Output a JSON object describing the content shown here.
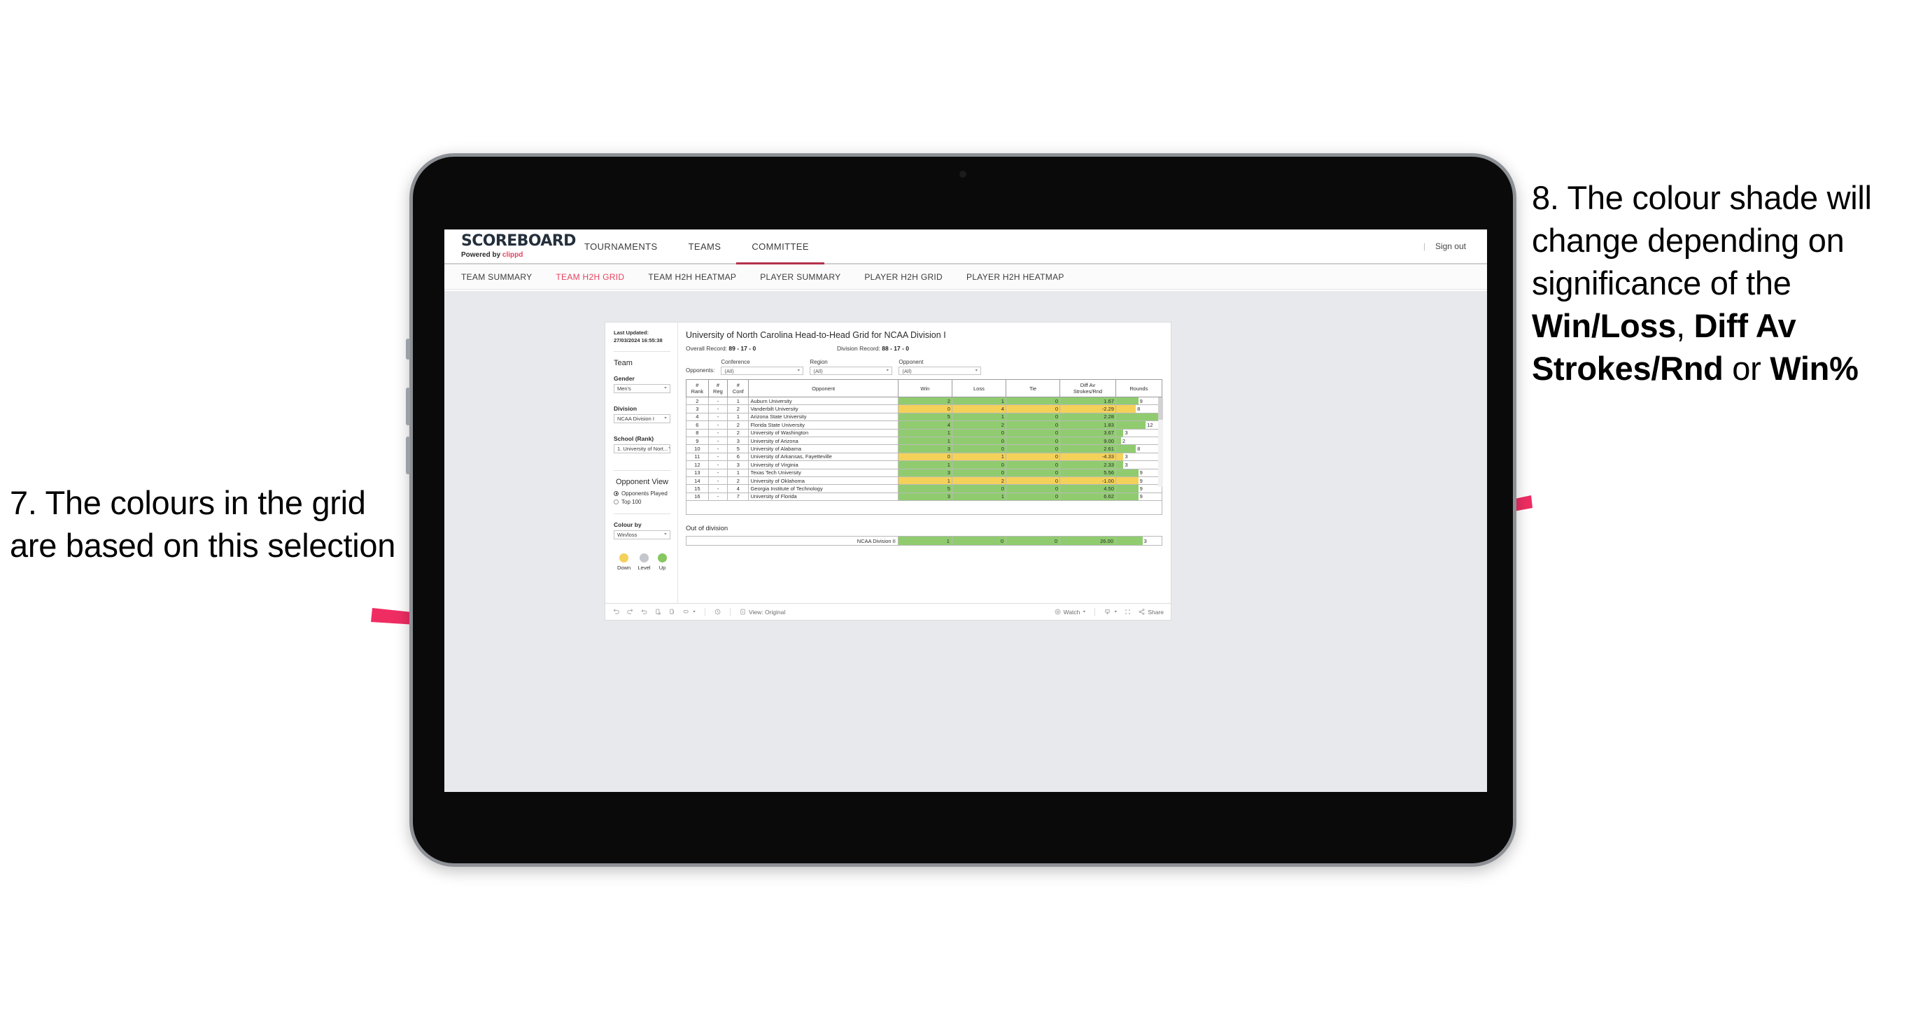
{
  "annotations": {
    "left": {
      "id": "7",
      "text": "7. The colours in the grid are based on this selection"
    },
    "right": {
      "id": "8",
      "line1": "8. The colour shade will change depending on significance of the ",
      "bold1": "Win/Loss",
      "mid1": ", ",
      "bold2": "Diff Av Strokes/Rnd",
      "mid2": " or ",
      "bold3": "Win%"
    },
    "arrow_color": "#ef2d63"
  },
  "app": {
    "brand": {
      "name": "SCOREBOARD",
      "powered_prefix": "Powered by ",
      "powered_brand": "clippd"
    },
    "top_nav": [
      {
        "label": "TOURNAMENTS",
        "active": false
      },
      {
        "label": "TEAMS",
        "active": false
      },
      {
        "label": "COMMITTEE",
        "active": true
      }
    ],
    "sign_out": "Sign out",
    "sub_nav": [
      {
        "label": "TEAM SUMMARY",
        "active": false
      },
      {
        "label": "TEAM H2H GRID",
        "active": true
      },
      {
        "label": "TEAM H2H HEATMAP",
        "active": false
      },
      {
        "label": "PLAYER SUMMARY",
        "active": false
      },
      {
        "label": "PLAYER H2H GRID",
        "active": false
      },
      {
        "label": "PLAYER H2H HEATMAP",
        "active": false
      }
    ]
  },
  "pane": {
    "last_updated_label": "Last Updated: ",
    "last_updated_value": "27/03/2024 16:55:38",
    "team_heading": "Team",
    "gender_label": "Gender",
    "gender_value": "Men's",
    "division_label": "Division",
    "division_value": "NCAA Division I",
    "school_label": "School (Rank)",
    "school_value": "1. University of Nort...",
    "opponent_view_heading": "Opponent View",
    "opponent_view_options": [
      {
        "label": "Opponents Played",
        "selected": true
      },
      {
        "label": "Top 100",
        "selected": false
      }
    ],
    "colour_by_label": "Colour by",
    "colour_by_value": "Win/loss",
    "legend": [
      {
        "label": "Down",
        "color": "#f4d159"
      },
      {
        "label": "Level",
        "color": "#c4c7cc"
      },
      {
        "label": "Up",
        "color": "#86c760"
      }
    ]
  },
  "viz": {
    "title": "University of North Carolina Head-to-Head Grid for NCAA Division I",
    "overall_record_label": "Overall Record: ",
    "overall_record_value": "89 - 17 - 0",
    "division_record_label": "Division Record: ",
    "division_record_value": "88 - 17 - 0",
    "opponents_label": "Opponents:",
    "filters": [
      {
        "label": "Conference",
        "value": "(All)"
      },
      {
        "label": "Region",
        "value": "(All)"
      },
      {
        "label": "Opponent",
        "value": "(All)"
      }
    ],
    "columns": [
      "# Rank",
      "# Reg",
      "# Conf",
      "Opponent",
      "Win",
      "Loss",
      "Tie",
      "Diff Av Strokes/Rnd",
      "Rounds"
    ],
    "columns_split": [
      {
        "l1": "#",
        "l2": "Rank"
      },
      {
        "l1": "#",
        "l2": "Reg"
      },
      {
        "l1": "#",
        "l2": "Conf"
      },
      {
        "l1": "",
        "l2": "Opponent"
      },
      {
        "l1": "",
        "l2": "Win"
      },
      {
        "l1": "",
        "l2": "Loss"
      },
      {
        "l1": "",
        "l2": "Tie"
      },
      {
        "l1": "Diff Av",
        "l2": "Strokes/Rnd"
      },
      {
        "l1": "",
        "l2": "Rounds"
      }
    ],
    "rows": [
      {
        "rank": "2",
        "reg": "-",
        "conf": "1",
        "opponent": "Auburn University",
        "win": "2",
        "loss": "1",
        "tie": "0",
        "diff": "1.67",
        "rounds": "9",
        "state": "up"
      },
      {
        "rank": "3",
        "reg": "-",
        "conf": "2",
        "opponent": "Vanderbilt University",
        "win": "0",
        "loss": "4",
        "tie": "0",
        "diff": "-2.29",
        "rounds": "8",
        "state": "down"
      },
      {
        "rank": "4",
        "reg": "-",
        "conf": "1",
        "opponent": "Arizona State University",
        "win": "5",
        "loss": "1",
        "tie": "0",
        "diff": "2.28",
        "rounds": "17",
        "state": "up"
      },
      {
        "rank": "6",
        "reg": "-",
        "conf": "2",
        "opponent": "Florida State University",
        "win": "4",
        "loss": "2",
        "tie": "0",
        "diff": "1.83",
        "rounds": "12",
        "state": "up"
      },
      {
        "rank": "8",
        "reg": "-",
        "conf": "2",
        "opponent": "University of Washington",
        "win": "1",
        "loss": "0",
        "tie": "0",
        "diff": "3.67",
        "rounds": "3",
        "state": "up"
      },
      {
        "rank": "9",
        "reg": "-",
        "conf": "3",
        "opponent": "University of Arizona",
        "win": "1",
        "loss": "0",
        "tie": "0",
        "diff": "9.00",
        "rounds": "2",
        "state": "up"
      },
      {
        "rank": "10",
        "reg": "-",
        "conf": "5",
        "opponent": "University of Alabama",
        "win": "3",
        "loss": "0",
        "tie": "0",
        "diff": "2.61",
        "rounds": "8",
        "state": "up"
      },
      {
        "rank": "11",
        "reg": "-",
        "conf": "6",
        "opponent": "University of Arkansas, Fayetteville",
        "win": "0",
        "loss": "1",
        "tie": "0",
        "diff": "-4.33",
        "rounds": "3",
        "state": "down"
      },
      {
        "rank": "12",
        "reg": "-",
        "conf": "3",
        "opponent": "University of Virginia",
        "win": "1",
        "loss": "0",
        "tie": "0",
        "diff": "2.33",
        "rounds": "3",
        "state": "up"
      },
      {
        "rank": "13",
        "reg": "-",
        "conf": "1",
        "opponent": "Texas Tech University",
        "win": "3",
        "loss": "0",
        "tie": "0",
        "diff": "5.56",
        "rounds": "9",
        "state": "up"
      },
      {
        "rank": "14",
        "reg": "-",
        "conf": "2",
        "opponent": "University of Oklahoma",
        "win": "1",
        "loss": "2",
        "tie": "0",
        "diff": "-1.00",
        "rounds": "9",
        "state": "down"
      },
      {
        "rank": "15",
        "reg": "-",
        "conf": "4",
        "opponent": "Georgia Institute of Technology",
        "win": "5",
        "loss": "0",
        "tie": "0",
        "diff": "4.50",
        "rounds": "9",
        "state": "up"
      },
      {
        "rank": "16",
        "reg": "-",
        "conf": "7",
        "opponent": "University of Florida",
        "win": "3",
        "loss": "1",
        "tie": "0",
        "diff": "6.62",
        "rounds": "9",
        "state": "up"
      }
    ],
    "out_of_division_label": "Out of division",
    "out_of_division_row": {
      "opponent": "NCAA Division II",
      "win": "1",
      "loss": "0",
      "tie": "0",
      "diff": "26.00",
      "rounds": "3",
      "state": "up"
    }
  },
  "toolbar": {
    "view_label": "View: Original",
    "watch_label": "Watch",
    "share_label": "Share"
  },
  "chart_data": {
    "type": "table",
    "title": "University of North Carolina Head-to-Head Grid for NCAA Division I",
    "categories": [
      "Auburn University",
      "Vanderbilt University",
      "Arizona State University",
      "Florida State University",
      "University of Washington",
      "University of Arizona",
      "University of Alabama",
      "University of Arkansas, Fayetteville",
      "University of Virginia",
      "Texas Tech University",
      "University of Oklahoma",
      "Georgia Institute of Technology",
      "University of Florida"
    ],
    "series": [
      {
        "name": "Win",
        "values": [
          2,
          0,
          5,
          4,
          1,
          1,
          3,
          0,
          1,
          3,
          1,
          5,
          3
        ]
      },
      {
        "name": "Loss",
        "values": [
          1,
          4,
          1,
          2,
          0,
          0,
          0,
          1,
          0,
          0,
          2,
          0,
          1
        ]
      },
      {
        "name": "Tie",
        "values": [
          0,
          0,
          0,
          0,
          0,
          0,
          0,
          0,
          0,
          0,
          0,
          0,
          0
        ]
      },
      {
        "name": "Diff Av Strokes/Rnd",
        "values": [
          1.67,
          -2.29,
          2.28,
          1.83,
          3.67,
          9.0,
          2.61,
          -4.33,
          2.33,
          5.56,
          -1.0,
          4.5,
          6.62
        ]
      },
      {
        "name": "Rounds",
        "values": [
          9,
          8,
          17,
          12,
          3,
          2,
          8,
          3,
          3,
          9,
          9,
          9,
          9
        ]
      }
    ],
    "colour_encoding": {
      "up": "#90cc6f",
      "down": "#f4d159",
      "level": "#c4c7cc"
    },
    "rounds_max": 17,
    "legend_position": "left-panel"
  }
}
